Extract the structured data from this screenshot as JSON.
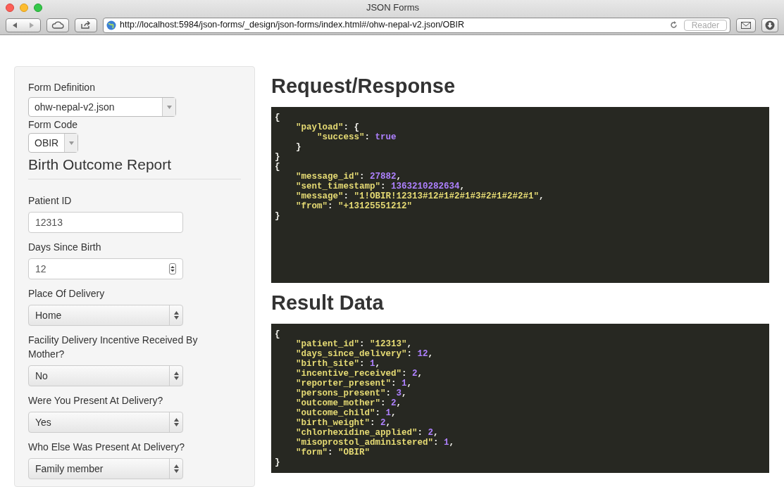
{
  "window": {
    "title": "JSON Forms"
  },
  "toolbar": {
    "url": "http://localhost:5984/json-forms/_design/json-forms/index.html#/ohw-nepal-v2.json/OBIR",
    "reader": "Reader"
  },
  "form": {
    "definition_label": "Form Definition",
    "definition_value": "ohw-nepal-v2.json",
    "code_label": "Form Code",
    "code_value": "OBIR",
    "title": "Birth Outcome Report",
    "fields": [
      {
        "kind": "text",
        "label": "Patient ID",
        "value": "12313"
      },
      {
        "kind": "number",
        "label": "Days Since Birth",
        "value": "12"
      },
      {
        "kind": "select",
        "label": "Place Of Delivery",
        "value": "Home"
      },
      {
        "kind": "select",
        "label": "Facility Delivery Incentive Received By Mother?",
        "value": "No"
      },
      {
        "kind": "select",
        "label": "Were You Present At Delivery?",
        "value": "Yes"
      },
      {
        "kind": "select",
        "label": "Who Else Was Present At Delivery?",
        "value": "Family member"
      }
    ]
  },
  "sections": [
    {
      "title": "Request/Response",
      "lines": [
        [
          {
            "kind": "p",
            "text": "{"
          }
        ],
        [
          {
            "kind": "s",
            "text": "    \"payload\""
          },
          {
            "kind": "p",
            "text": ": {"
          }
        ],
        [
          {
            "kind": "s",
            "text": "        \"success\""
          },
          {
            "kind": "p",
            "text": ": "
          },
          {
            "kind": "n",
            "text": "true"
          }
        ],
        [
          {
            "kind": "p",
            "text": "    }"
          }
        ],
        [
          {
            "kind": "p",
            "text": "}"
          }
        ],
        [
          {
            "kind": "p",
            "text": "{"
          }
        ],
        [
          {
            "kind": "s",
            "text": "    \"message_id\""
          },
          {
            "kind": "p",
            "text": ": "
          },
          {
            "kind": "n",
            "text": "27882"
          },
          {
            "kind": "p",
            "text": ","
          }
        ],
        [
          {
            "kind": "s",
            "text": "    \"sent_timestamp\""
          },
          {
            "kind": "p",
            "text": ": "
          },
          {
            "kind": "n",
            "text": "1363210282634"
          },
          {
            "kind": "p",
            "text": ","
          }
        ],
        [
          {
            "kind": "s",
            "text": "    \"message\""
          },
          {
            "kind": "p",
            "text": ": "
          },
          {
            "kind": "s",
            "text": "\"1!OBIR!12313#12#1#2#1#3#2#1#2#2#1\""
          },
          {
            "kind": "p",
            "text": ","
          }
        ],
        [
          {
            "kind": "s",
            "text": "    \"from\""
          },
          {
            "kind": "p",
            "text": ": "
          },
          {
            "kind": "s",
            "text": "\"+13125551212\""
          }
        ],
        [
          {
            "kind": "p",
            "text": "}"
          }
        ]
      ]
    },
    {
      "title": "Result Data",
      "lines": [
        [
          {
            "kind": "p",
            "text": "{"
          }
        ],
        [
          {
            "kind": "s",
            "text": "    \"patient_id\""
          },
          {
            "kind": "p",
            "text": ": "
          },
          {
            "kind": "s",
            "text": "\"12313\""
          },
          {
            "kind": "p",
            "text": ","
          }
        ],
        [
          {
            "kind": "s",
            "text": "    \"days_since_delivery\""
          },
          {
            "kind": "p",
            "text": ": "
          },
          {
            "kind": "n",
            "text": "12"
          },
          {
            "kind": "p",
            "text": ","
          }
        ],
        [
          {
            "kind": "s",
            "text": "    \"birth_site\""
          },
          {
            "kind": "p",
            "text": ": "
          },
          {
            "kind": "n",
            "text": "1"
          },
          {
            "kind": "p",
            "text": ","
          }
        ],
        [
          {
            "kind": "s",
            "text": "    \"incentive_received\""
          },
          {
            "kind": "p",
            "text": ": "
          },
          {
            "kind": "n",
            "text": "2"
          },
          {
            "kind": "p",
            "text": ","
          }
        ],
        [
          {
            "kind": "s",
            "text": "    \"reporter_present\""
          },
          {
            "kind": "p",
            "text": ": "
          },
          {
            "kind": "n",
            "text": "1"
          },
          {
            "kind": "p",
            "text": ","
          }
        ],
        [
          {
            "kind": "s",
            "text": "    \"persons_present\""
          },
          {
            "kind": "p",
            "text": ": "
          },
          {
            "kind": "n",
            "text": "3"
          },
          {
            "kind": "p",
            "text": ","
          }
        ],
        [
          {
            "kind": "s",
            "text": "    \"outcome_mother\""
          },
          {
            "kind": "p",
            "text": ": "
          },
          {
            "kind": "n",
            "text": "2"
          },
          {
            "kind": "p",
            "text": ","
          }
        ],
        [
          {
            "kind": "s",
            "text": "    \"outcome_child\""
          },
          {
            "kind": "p",
            "text": ": "
          },
          {
            "kind": "n",
            "text": "1"
          },
          {
            "kind": "p",
            "text": ","
          }
        ],
        [
          {
            "kind": "s",
            "text": "    \"birth_weight\""
          },
          {
            "kind": "p",
            "text": ": "
          },
          {
            "kind": "n",
            "text": "2"
          },
          {
            "kind": "p",
            "text": ","
          }
        ],
        [
          {
            "kind": "s",
            "text": "    \"chlorhexidine_applied\""
          },
          {
            "kind": "p",
            "text": ": "
          },
          {
            "kind": "n",
            "text": "2"
          },
          {
            "kind": "p",
            "text": ","
          }
        ],
        [
          {
            "kind": "s",
            "text": "    \"misoprostol_administered\""
          },
          {
            "kind": "p",
            "text": ": "
          },
          {
            "kind": "n",
            "text": "1"
          },
          {
            "kind": "p",
            "text": ","
          }
        ],
        [
          {
            "kind": "s",
            "text": "    \"form\""
          },
          {
            "kind": "p",
            "text": ": "
          },
          {
            "kind": "s",
            "text": "\"OBIR\""
          }
        ],
        [
          {
            "kind": "p",
            "text": "}"
          }
        ]
      ]
    }
  ]
}
